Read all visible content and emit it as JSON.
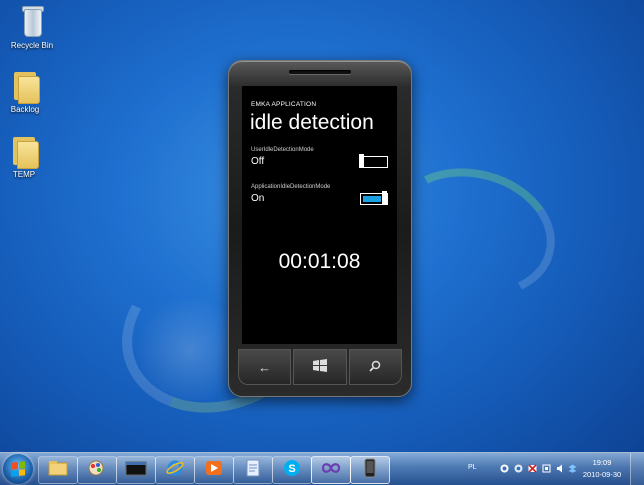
{
  "desktop": {
    "icons": [
      {
        "label": "Recycle Bin",
        "icon": "recycle-bin-icon"
      },
      {
        "label": "Backlog",
        "icon": "folder-icon"
      },
      {
        "label": "TEMP",
        "icon": "folder-icon"
      }
    ]
  },
  "phone": {
    "app_title": "EMKA APPLICATION",
    "page_title": "idle detection",
    "settings": [
      {
        "label": "UserIdleDetectionMode",
        "value": "Off",
        "enabled": false
      },
      {
        "label": "ApplicationIdleDetectionMode",
        "value": "On",
        "enabled": true
      }
    ],
    "timer": "00:01:08",
    "buttons": {
      "back": "←",
      "start": "windows-flag-icon",
      "search": "search-icon"
    }
  },
  "taskbar": {
    "apps": [
      "explorer-folder-icon",
      "paint-icon",
      "console-icon",
      "internet-explorer-icon",
      "media-player-icon",
      "document-icon",
      "skype-icon",
      "visual-studio-icon",
      "phone-emulator-icon"
    ],
    "tray": {
      "language": "PL",
      "time": "19:09",
      "date": "2010-09-30"
    }
  },
  "colors": {
    "accent": "#1ba1e2",
    "desktop": "#1e6fcf"
  }
}
